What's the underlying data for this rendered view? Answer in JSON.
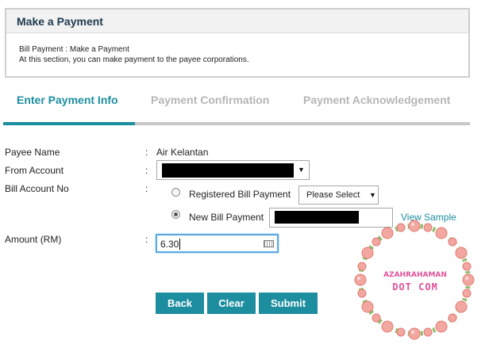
{
  "panel": {
    "title": "Make a Payment",
    "line1": "Bill Payment : Make a Payment",
    "line2": "At this section, you can make payment to the payee corporations."
  },
  "tabs": [
    {
      "label": "Enter Payment Info",
      "active": true
    },
    {
      "label": "Payment Confirmation",
      "active": false
    },
    {
      "label": "Payment Acknowledgement",
      "active": false
    }
  ],
  "form": {
    "colon": ":",
    "payee_label": "Payee Name",
    "payee_value": "Air Kelantan",
    "from_label": "From Account",
    "bill_label": "Bill Account No",
    "registered_label": "Registered Bill Payment",
    "registered_select": "Please Select",
    "new_label": "New Bill Payment",
    "view_sample": "View Sample",
    "amount_label": "Amount (RM)",
    "amount_value": "6.30",
    "selected_option": "new"
  },
  "buttons": {
    "back": "Back",
    "clear": "Clear",
    "submit": "Submit"
  },
  "watermark": {
    "line1": "AZAHRAHAMAN",
    "line2": "DOT COM"
  },
  "colors": {
    "accent": "#1d8ea0",
    "inactive_tab": "#b6b6b6",
    "watermark": "#e0529a"
  }
}
